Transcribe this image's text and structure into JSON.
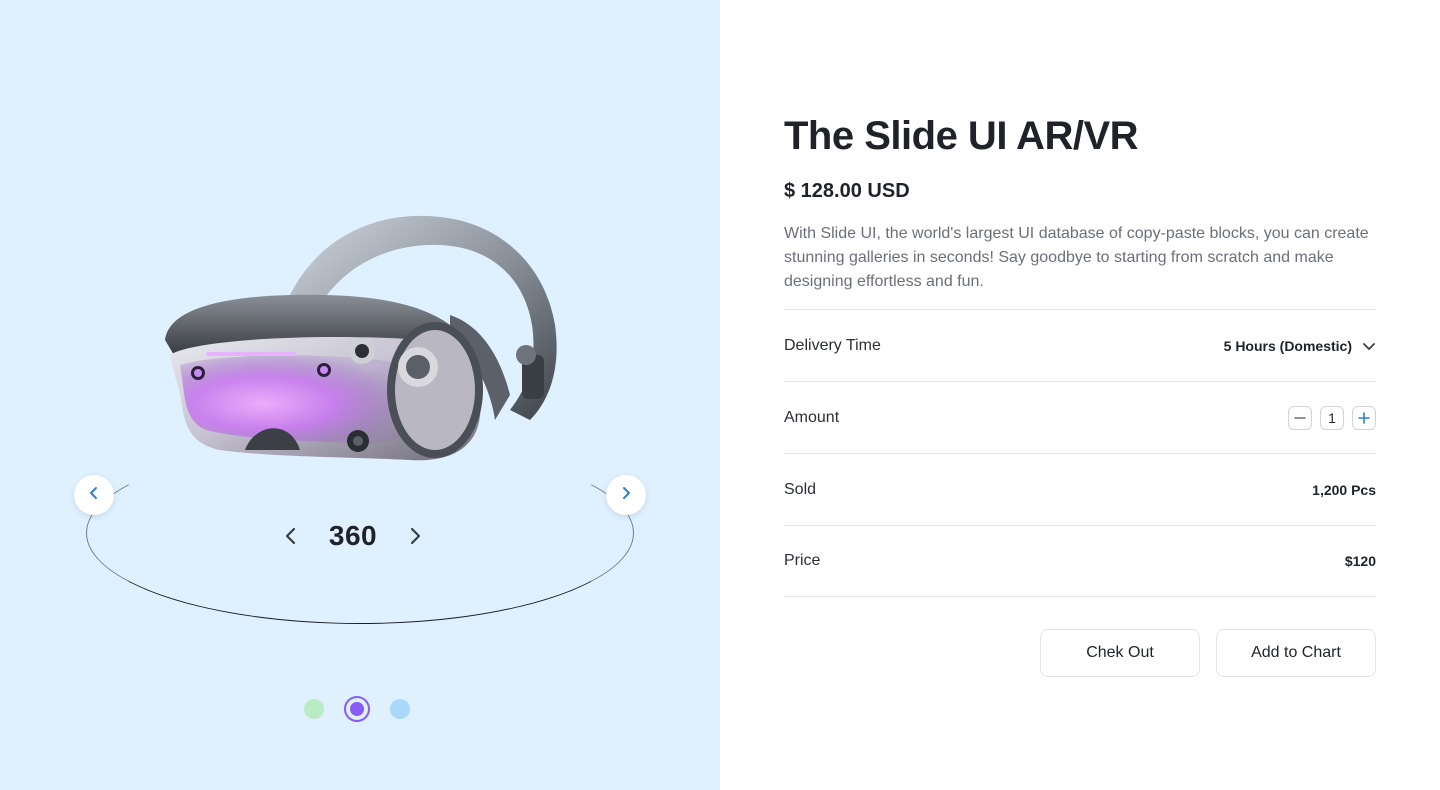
{
  "product": {
    "title": "The Slide UI AR/VR",
    "price": "$ 128.00 USD",
    "description": "With Slide UI, the world's largest UI database of copy-paste blocks, you can create stunning galleries in seconds! Say goodbye to starting from scratch and make designing effortless and fun."
  },
  "viewer": {
    "rotation_label": "360",
    "image_alt": "VR headset",
    "slides": [
      {
        "color": "#b9ecc3",
        "active": false
      },
      {
        "color": "#8a5cf6",
        "active": true
      },
      {
        "color": "#a9d8fb",
        "active": false
      }
    ]
  },
  "details": {
    "delivery": {
      "label": "Delivery Time",
      "value": "5 Hours (Domestic)"
    },
    "amount": {
      "label": "Amount",
      "value": "1"
    },
    "sold": {
      "label": "Sold",
      "value": "1,200 Pcs"
    },
    "price": {
      "label": "Price",
      "value": "$120"
    }
  },
  "actions": {
    "checkout": "Chek Out",
    "add_to_cart": "Add to Chart"
  },
  "colors": {
    "left_bg": "#dff0fe",
    "accent_blue": "#2f7fd0",
    "accent_purple": "#8a5cf6"
  }
}
